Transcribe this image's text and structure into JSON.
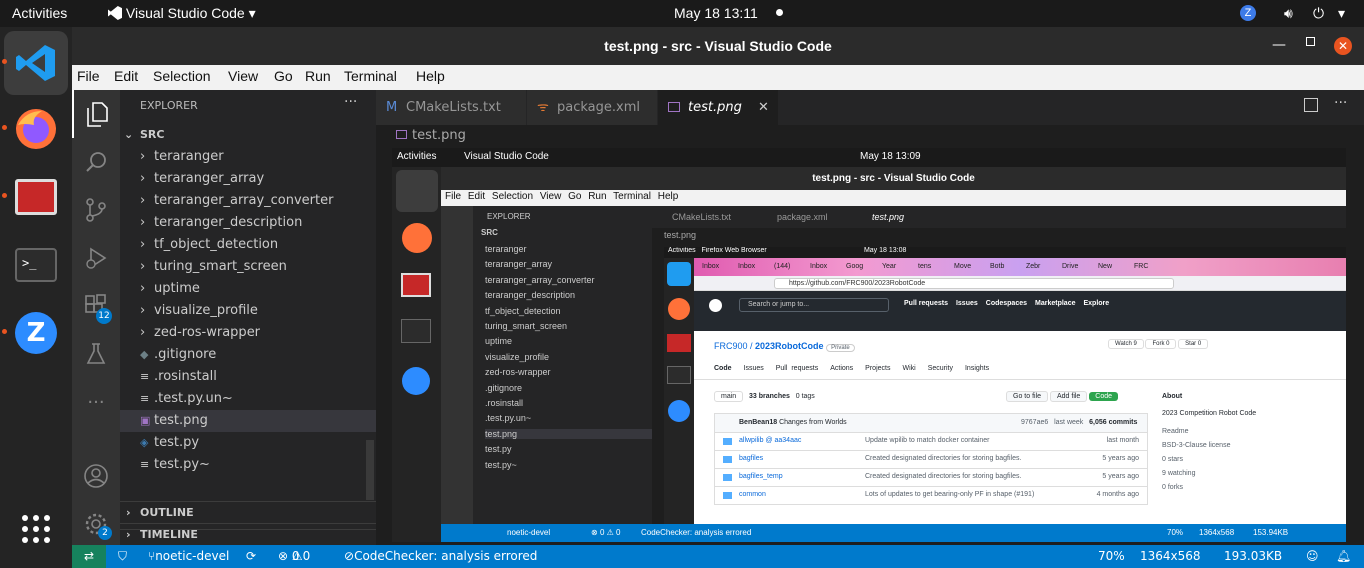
{
  "topbar": {
    "activities": "Activities",
    "app_name": "Visual Studio Code",
    "clock": "May 18  13:11"
  },
  "window": {
    "title": "test.png - src - Visual Studio Code"
  },
  "menu": [
    "File",
    "Edit",
    "Selection",
    "View",
    "Go",
    "Run",
    "Terminal",
    "Help"
  ],
  "activity_badges": {
    "extensions": "12",
    "accounts": "2"
  },
  "sidebar": {
    "header": "EXPLORER",
    "folder": "SRC",
    "items": [
      {
        "label": "teraranger",
        "type": "folder"
      },
      {
        "label": "teraranger_array",
        "type": "folder"
      },
      {
        "label": "teraranger_array_converter",
        "type": "folder"
      },
      {
        "label": "teraranger_description",
        "type": "folder"
      },
      {
        "label": "tf_object_detection",
        "type": "folder"
      },
      {
        "label": "turing_smart_screen",
        "type": "folder"
      },
      {
        "label": "uptime",
        "type": "folder"
      },
      {
        "label": "visualize_profile",
        "type": "folder"
      },
      {
        "label": "zed-ros-wrapper",
        "type": "folder"
      },
      {
        "label": ".gitignore",
        "type": "file"
      },
      {
        "label": ".rosinstall",
        "type": "file"
      },
      {
        "label": ".test.py.un~",
        "type": "file"
      },
      {
        "label": "test.png",
        "type": "file",
        "selected": true
      },
      {
        "label": "test.py",
        "type": "file"
      },
      {
        "label": "test.py~",
        "type": "file"
      }
    ],
    "outline": "OUTLINE",
    "timeline": "TIMELINE"
  },
  "tabs": [
    {
      "label": "CMakeLists.txt",
      "active": false
    },
    {
      "label": "package.xml",
      "active": false
    },
    {
      "label": "test.png",
      "active": true
    }
  ],
  "breadcrumb": "test.png",
  "statusbar": {
    "branch": "noetic-devel",
    "problems": "0",
    "warnings": "0",
    "codechecker": "CodeChecker: analysis errored",
    "zoom": "70%",
    "dimensions": "1364x568",
    "size": "193.03KB"
  },
  "nested": {
    "clock": "May 18  13:09",
    "statusbar_size": "153.94KB",
    "statusbar_zoom": "70%",
    "statusbar_dim": "1364x568",
    "firefox_title": "Firefox Web Browser",
    "firefox_clock": "May 18  13:08",
    "url": "https://github.com/FRC900/2023RobotCode",
    "search": "Search or jump to...",
    "gh_nav": [
      "Pull requests",
      "Issues",
      "Codespaces",
      "Marketplace",
      "Explore"
    ],
    "repo_owner": "FRC900",
    "repo_name": "2023RobotCode",
    "repo_visibility": "Private",
    "repo_tabs": [
      "Code",
      "Issues",
      "Pull requests",
      "Actions",
      "Projects",
      "Wiki",
      "Security",
      "Insights"
    ],
    "pull_count": "3",
    "watch": "Watch",
    "watch_count": "9",
    "fork": "Fork",
    "fork_count": "0",
    "star": "Star",
    "star_count": "0",
    "branch_btn": "main",
    "branches": "33 branches",
    "tags": "0 tags",
    "goto": "Go to file",
    "addfile": "Add file",
    "code": "Code",
    "commit_user": "BenBean18",
    "commit_msg": "Changes from Worlds",
    "commit_hash": "9767ae6",
    "commit_when": "last week",
    "commit_count": "6,056 commits",
    "files": [
      {
        "name": "allwpilib @ aa34aac",
        "msg": "Update wpilib to match docker container",
        "time": "last month"
      },
      {
        "name": "bagfiles",
        "msg": "Created designated directories for storing bagfiles.",
        "time": "5 years ago"
      },
      {
        "name": "bagfiles_temp",
        "msg": "Created designated directories for storing bagfiles.",
        "time": "5 years ago"
      },
      {
        "name": "common",
        "msg": "Lots of updates to get bearing-only PF in shape (#191)",
        "time": "4 months ago"
      }
    ],
    "about": "About",
    "about_desc": "2023 Competition Robot Code",
    "about_items": [
      "Readme",
      "BSD-3-Clause license",
      "0 stars",
      "9 watching",
      "0 forks"
    ],
    "ff_tabs": [
      "Inbox",
      "Inbox",
      "(144)",
      "Inbox",
      "Goog",
      "Year",
      "tens",
      "Move",
      "Botb",
      "Zebr",
      "Drive",
      "New",
      "FRC"
    ]
  },
  "colors": {
    "accent": "#007acc",
    "ubuntu_orange": "#e95420",
    "github_green": "#2da44e"
  }
}
